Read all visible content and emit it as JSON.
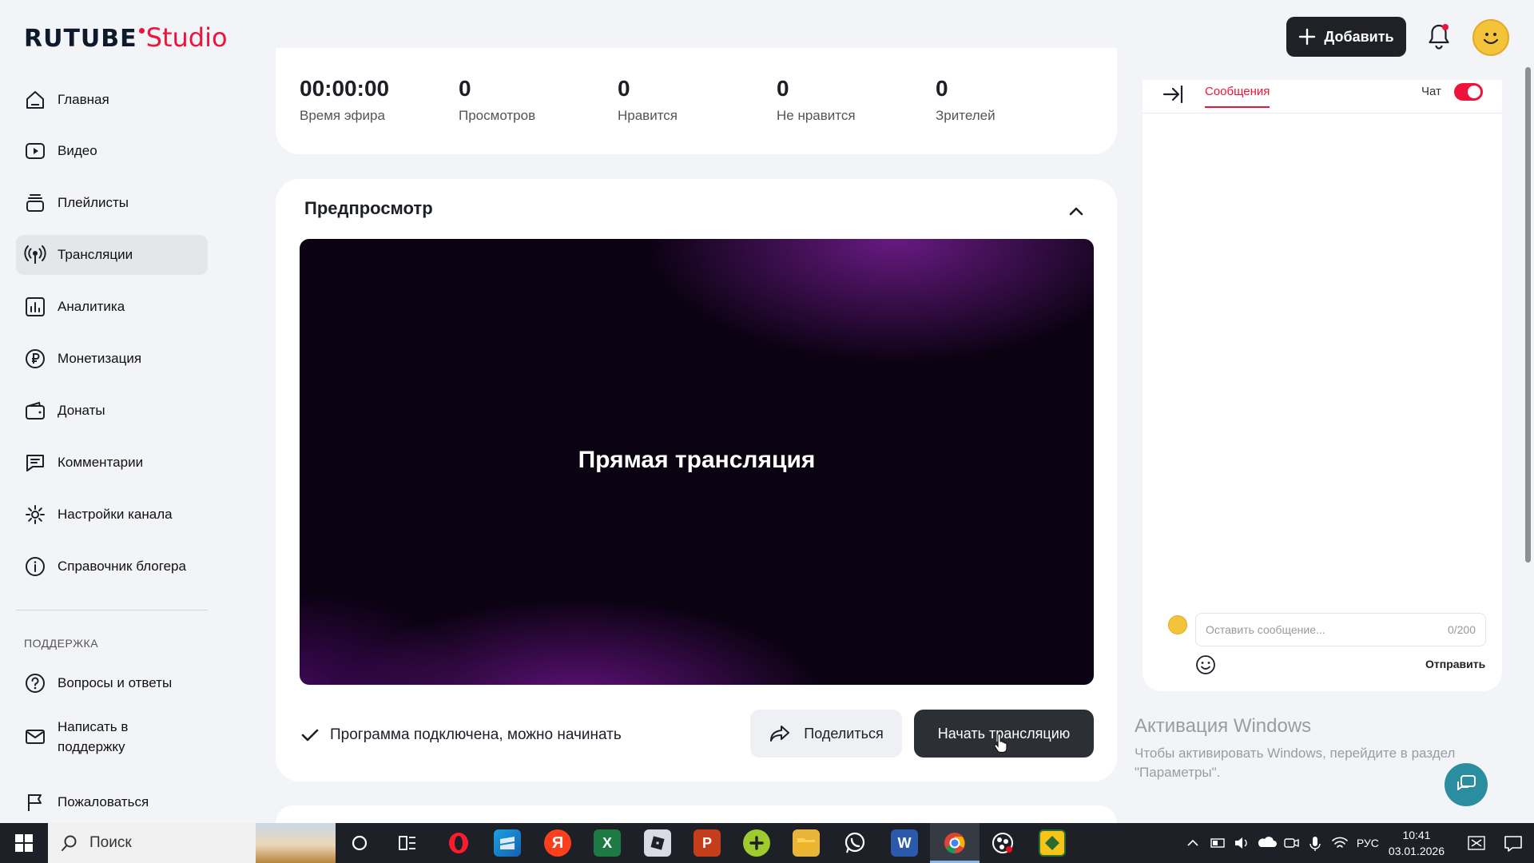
{
  "header": {
    "logo_main": "RUTUBE",
    "logo_sub": "Studio",
    "add_label": "Добавить"
  },
  "sidebar": {
    "items": [
      {
        "label": "Главная"
      },
      {
        "label": "Видео"
      },
      {
        "label": "Плейлисты"
      },
      {
        "label": "Трансляции"
      },
      {
        "label": "Аналитика"
      },
      {
        "label": "Монетизация"
      },
      {
        "label": "Донаты"
      },
      {
        "label": "Комментарии"
      },
      {
        "label": "Настройки канала"
      },
      {
        "label": "Справочник блогера"
      }
    ],
    "section_title": "ПОДДЕРЖКА",
    "support_items": [
      {
        "label": "Вопросы и ответы"
      },
      {
        "label": "Написать в поддержку"
      },
      {
        "label": "Пожаловаться"
      }
    ]
  },
  "stats": [
    {
      "value": "00:00:00",
      "label": "Время эфира"
    },
    {
      "value": "0",
      "label": "Просмотров"
    },
    {
      "value": "0",
      "label": "Нравится"
    },
    {
      "value": "0",
      "label": "Не нравится"
    },
    {
      "value": "0",
      "label": "Зрителей"
    }
  ],
  "preview": {
    "title": "Предпросмотр",
    "video_title": "Прямая трансляция",
    "status": "Программа подключена, можно начинать",
    "share_label": "Поделиться",
    "start_label": "Начать трансляцию"
  },
  "chat": {
    "tab_label": "Сообщения",
    "toggle_label": "Чат",
    "toggle_on": true,
    "input_placeholder": "Оставить сообщение...",
    "counter": "0/200",
    "send_label": "Отправить"
  },
  "windows_activation": {
    "title": "Активация Windows",
    "subtitle": "Чтобы активировать Windows, перейдите в раздел \"Параметры\"."
  },
  "taskbar": {
    "search_label": "Поиск",
    "language": "РУС",
    "time": "10:41",
    "date": "03.01.2026"
  },
  "colors": {
    "brand_red": "#ed143b",
    "dark_button": "#2c2f36",
    "page_bg": "#f3f4f7"
  }
}
